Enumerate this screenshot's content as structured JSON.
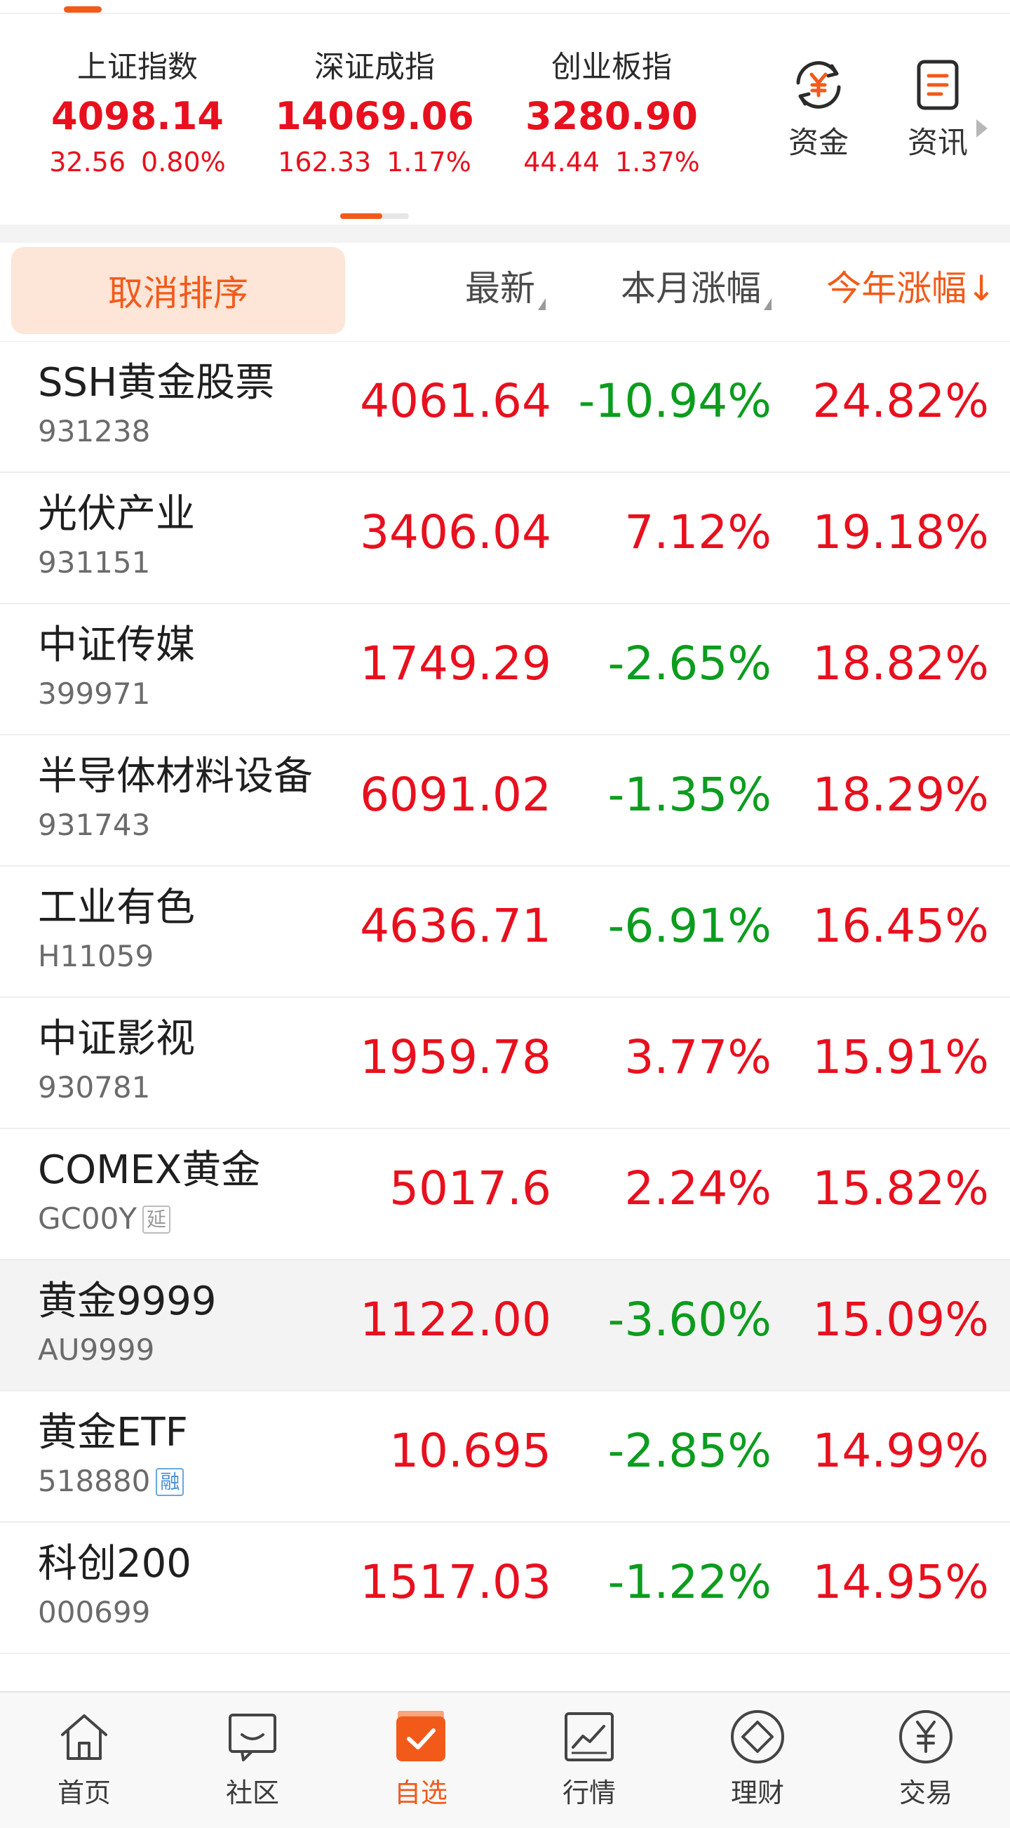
{
  "indices": [
    {
      "name": "上证指数",
      "value": "4098.14",
      "change": "32.56",
      "pct": "0.80%"
    },
    {
      "name": "深证成指",
      "value": "14069.06",
      "change": "162.33",
      "pct": "1.17%"
    },
    {
      "name": "创业板指",
      "value": "3280.90",
      "change": "44.44",
      "pct": "1.37%"
    }
  ],
  "quick_links": [
    {
      "label": "资金",
      "icon": "yuan-exchange-icon"
    },
    {
      "label": "资讯",
      "icon": "news-doc-icon"
    }
  ],
  "header": {
    "cancel_sort": "取消排序",
    "col_latest": "最新",
    "col_month": "本月涨幅",
    "col_year": "今年涨幅",
    "sort_arrow": "↓"
  },
  "rows": [
    {
      "name": "SSH黄金股票",
      "code": "931238",
      "badge": "",
      "latest": "4061.64",
      "month": "-10.94%",
      "year": "24.82%"
    },
    {
      "name": "光伏产业",
      "code": "931151",
      "badge": "",
      "latest": "3406.04",
      "month": "7.12%",
      "year": "19.18%"
    },
    {
      "name": "中证传媒",
      "code": "399971",
      "badge": "",
      "latest": "1749.29",
      "month": "-2.65%",
      "year": "18.82%"
    },
    {
      "name": "半导体材料设备",
      "code": "931743",
      "badge": "",
      "latest": "6091.02",
      "month": "-1.35%",
      "year": "18.29%"
    },
    {
      "name": "工业有色",
      "code": "H11059",
      "badge": "",
      "latest": "4636.71",
      "month": "-6.91%",
      "year": "16.45%"
    },
    {
      "name": "中证影视",
      "code": "930781",
      "badge": "",
      "latest": "1959.78",
      "month": "3.77%",
      "year": "15.91%"
    },
    {
      "name": "COMEX黄金",
      "code": "GC00Y",
      "badge": "延",
      "latest": "5017.6",
      "month": "2.24%",
      "year": "15.82%"
    },
    {
      "name": "黄金9999",
      "code": "AU9999",
      "badge": "",
      "latest": "1122.00",
      "month": "-3.60%",
      "year": "15.09%"
    },
    {
      "name": "黄金ETF",
      "code": "518880",
      "badge": "融",
      "latest": "10.695",
      "month": "-2.85%",
      "year": "14.99%"
    },
    {
      "name": "科创200",
      "code": "000699",
      "badge": "",
      "latest": "1517.03",
      "month": "-1.22%",
      "year": "14.95%"
    }
  ],
  "nav": [
    {
      "label": "首页",
      "icon": "home-icon"
    },
    {
      "label": "社区",
      "icon": "chat-bubble-icon"
    },
    {
      "label": "自选",
      "icon": "watchlist-check-icon"
    },
    {
      "label": "行情",
      "icon": "market-chart-icon"
    },
    {
      "label": "理财",
      "icon": "diamond-icon"
    },
    {
      "label": "交易",
      "icon": "yuan-circle-icon"
    }
  ],
  "colors": {
    "up": "#e8101e",
    "down": "#0c9c1e",
    "accent": "#f25a1a",
    "cancel_bg": "#fde5d7"
  }
}
